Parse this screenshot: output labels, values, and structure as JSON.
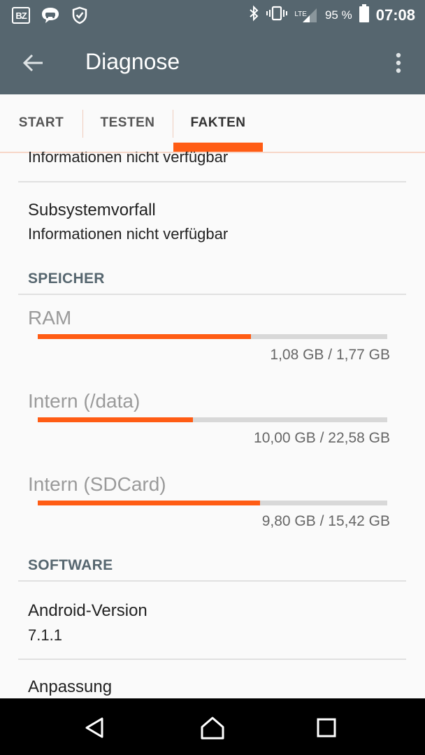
{
  "status_bar": {
    "left_icons": [
      "bz-news-icon",
      "car-chat-icon",
      "shield-check-icon"
    ],
    "bz_text": "BZ",
    "right_icons": [
      "bluetooth-icon",
      "vibrate-icon",
      "signal-icon",
      "battery-icon"
    ],
    "network": "LTE",
    "battery": "95 %",
    "time": "07:08"
  },
  "app_bar": {
    "title": "Diagnose"
  },
  "tabs": [
    {
      "label": "START",
      "active": false
    },
    {
      "label": "TESTEN",
      "active": false
    },
    {
      "label": "FAKTEN",
      "active": true
    }
  ],
  "accent_color": "#ff5c14",
  "header_color": "#56666f",
  "content": {
    "partial_row": {
      "value": "Informationen nicht verfügbar"
    },
    "subsystem": {
      "title": "Subsystemvorfall",
      "value": "Informationen nicht verfügbar"
    },
    "memory_section": {
      "header": "SPEICHER",
      "items": [
        {
          "label": "RAM",
          "value": "1,08 GB / 1,77 GB",
          "fraction": 0.61
        },
        {
          "label": "Intern (/data)",
          "value": "10,00 GB / 22,58 GB",
          "fraction": 0.443
        },
        {
          "label": "Intern (SDCard)",
          "value": "9,80 GB / 15,42 GB",
          "fraction": 0.636
        }
      ]
    },
    "software_section": {
      "header": "SOFTWARE",
      "android": {
        "title": "Android-Version",
        "value": "7.1.1"
      },
      "customization": {
        "title": "Anpassung"
      }
    }
  },
  "nav_bar": [
    "back-triangle-icon",
    "home-icon",
    "recents-icon"
  ]
}
